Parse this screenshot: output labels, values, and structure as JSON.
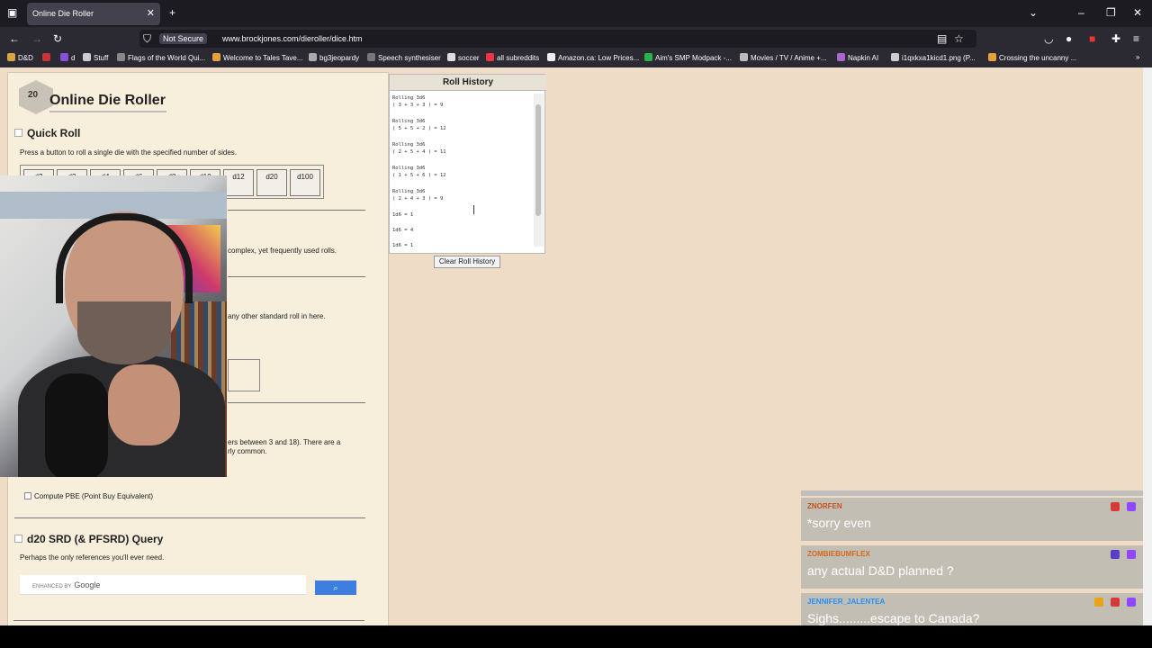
{
  "browser": {
    "tab_title": "Online Die Roller",
    "not_secure": "Not Secure",
    "url": "www.brockjones.com/dieroller/dice.htm"
  },
  "bookmarks": [
    "D&D",
    "d",
    "Stuff",
    "Flags of the World Qui...",
    "Welcome to Tales Tave...",
    "bg3jeopardy",
    "Speech synthesiser",
    "soccer",
    "all subreddits",
    "Amazon.ca: Low Prices...",
    "Aim's SMP Modpack -...",
    "Movies / TV / Anime +...",
    "Napkin AI",
    "i1qxkxa1kicd1.png (P...",
    "Crossing the uncanny ..."
  ],
  "site": {
    "logo_text": "20",
    "title": "Online Die Roller"
  },
  "quick_roll": {
    "heading": "Quick Roll",
    "description": "Press a button to roll a single die with the specified number of sides.",
    "dice": [
      "d2",
      "d3",
      "d4",
      "d6",
      "d8",
      "d10",
      "d12",
      "d20",
      "d100"
    ]
  },
  "visible_fragments": {
    "complex": "complex, yet frequently used rolls.",
    "other": "any other standard roll in here.",
    "between": "ers between 3 and 18). There are a",
    "common": "rly common."
  },
  "pbe_label": "Compute PBE (Point Buy Equivalent)",
  "srd": {
    "heading": "d20 SRD (& PFSRD) Query",
    "description": "Perhaps the only references you'll ever need.",
    "search_prefix": "ENHANCED BY",
    "search_brand": "Google"
  },
  "roll_history": {
    "title": "Roll History",
    "lines": [
      "Rolling 3d6",
      "( 3 + 3 + 3 ) = 9",
      "Rolling 3d6",
      "( 5 + 5 + 2 ) = 12",
      "Rolling 3d6",
      "( 2 + 5 + 4 ) = 11",
      "Rolling 3d6",
      "( 1 + 5 + 6 ) = 12",
      "Rolling 3d6",
      "( 2 + 4 + 3 ) = 9",
      "1d6 = 1",
      "1d6 = 4",
      "1d6 = 1"
    ],
    "clear_button": "Clear Roll History"
  },
  "chat": [
    {
      "name": "ZNORFEN",
      "text": "*sorry even",
      "name_color": "#c94f1a"
    },
    {
      "name": "ZOMBIEBUMFLEX",
      "text": "any actual D&D planned ?",
      "name_color": "#d2691e"
    },
    {
      "name": "JENNIFER_JALENTEA",
      "text": "Sighs.........escape to Canada?",
      "name_color": "#1e90ff"
    }
  ]
}
